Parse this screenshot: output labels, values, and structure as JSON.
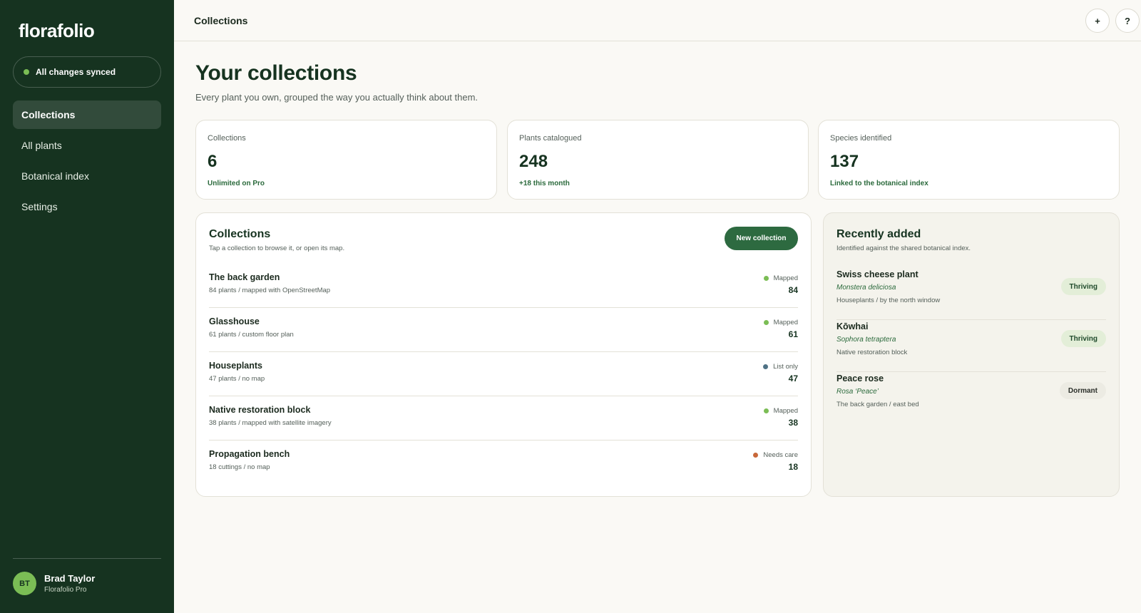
{
  "app": {
    "brand": "florafolio",
    "sync_status": "All changes synced",
    "sync_color": "#7bbd55"
  },
  "sidebar": {
    "items": [
      {
        "label": "Collections",
        "active": true
      },
      {
        "label": "All plants",
        "active": false
      },
      {
        "label": "Botanical index",
        "active": false
      },
      {
        "label": "Settings",
        "active": false
      }
    ],
    "user": {
      "initials": "BT",
      "name": "Brad Taylor",
      "plan": "Florafolio Pro"
    }
  },
  "topbar": {
    "title": "Collections",
    "add_icon": "plus-icon",
    "add_label": "+",
    "help_icon": "help-icon",
    "help_label": "?"
  },
  "main": {
    "title": "Your collections",
    "subtitle": "Every plant you own, grouped the way you actually think about them.",
    "stats": [
      {
        "label": "Collections",
        "value": "6",
        "note": "Unlimited on Pro"
      },
      {
        "label": "Plants catalogued",
        "value": "248",
        "note": "+18 this month"
      },
      {
        "label": "Species identified",
        "value": "137",
        "note": "Linked to the botanical index"
      }
    ]
  },
  "collections_panel": {
    "title": "Collections",
    "subtitle": "Tap a collection to browse it, or open its map.",
    "new_button": "New collection",
    "rows": [
      {
        "name": "The back garden",
        "desc": "84 plants / mapped with OpenStreetMap",
        "status": "Mapped",
        "status_color": "#7bbd55",
        "count": "84"
      },
      {
        "name": "Glasshouse",
        "desc": "61 plants / custom floor plan",
        "status": "Mapped",
        "status_color": "#7bbd55",
        "count": "61"
      },
      {
        "name": "Houseplants",
        "desc": "47 plants / no map",
        "status": "List only",
        "status_color": "#4f7285",
        "count": "47"
      },
      {
        "name": "Native restoration block",
        "desc": "38 plants / mapped with satellite imagery",
        "status": "Mapped",
        "status_color": "#7bbd55",
        "count": "38"
      },
      {
        "name": "Propagation bench",
        "desc": "18 cuttings / no map",
        "status": "Needs care",
        "status_color": "#c8683a",
        "count": "18"
      }
    ]
  },
  "recent_panel": {
    "title": "Recently added",
    "subtitle": "Identified against the shared botanical index.",
    "rows": [
      {
        "name": "Swiss cheese plant",
        "latin": "Monstera deliciosa",
        "location": "Houseplants / by the north window",
        "badge": "Thriving",
        "badge_type": "thriving"
      },
      {
        "name": "Kōwhai",
        "latin": "Sophora tetraptera",
        "location": "Native restoration block",
        "badge": "Thriving",
        "badge_type": "thriving"
      },
      {
        "name": "Peace rose",
        "latin": "Rosa ‘Peace’",
        "location": "The back garden / east bed",
        "badge": "Dormant",
        "badge_type": "dormant"
      }
    ]
  }
}
